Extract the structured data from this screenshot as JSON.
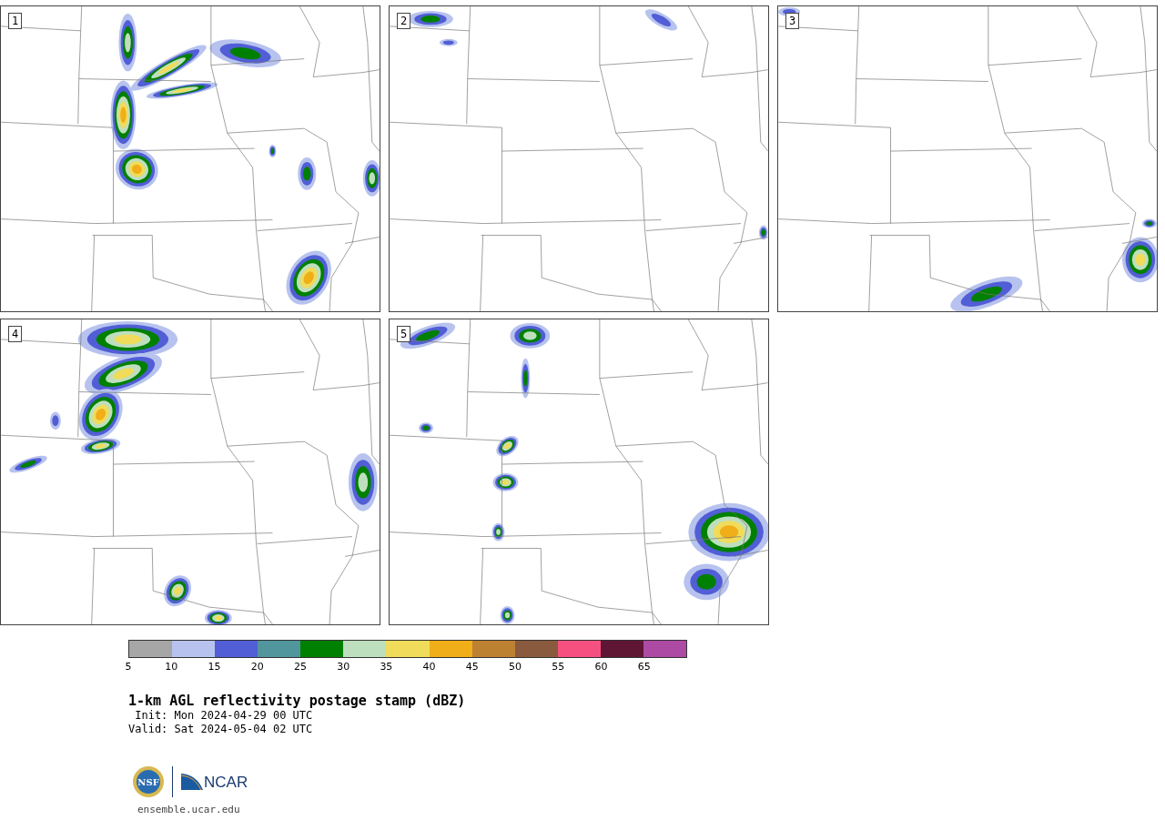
{
  "panels": [
    {
      "label": "1"
    },
    {
      "label": "2"
    },
    {
      "label": "3"
    },
    {
      "label": "4"
    },
    {
      "label": "5"
    }
  ],
  "colorbar": {
    "segments": [
      {
        "color": "#a6a6a6"
      },
      {
        "color": "#b7c3ee"
      },
      {
        "color": "#515ed6"
      },
      {
        "color": "#51969c"
      },
      {
        "color": "#008000"
      },
      {
        "color": "#bedfbe"
      },
      {
        "color": "#f0dc5a"
      },
      {
        "color": "#f0ae18"
      },
      {
        "color": "#bc8232"
      },
      {
        "color": "#8a5a3e"
      },
      {
        "color": "#f55080"
      },
      {
        "color": "#5e1634"
      },
      {
        "color": "#ac4aa4"
      }
    ],
    "ticks": [
      "5",
      "10",
      "15",
      "20",
      "25",
      "30",
      "35",
      "40",
      "45",
      "50",
      "55",
      "60",
      "65"
    ]
  },
  "title": "1-km AGL reflectivity postage stamp (dBZ)",
  "init": " Init: Mon 2024-04-29 00 UTC",
  "valid": "Valid: Sat 2024-05-04 02 UTC",
  "logos": {
    "nsf": "NSF",
    "ncar": "NCAR"
  },
  "footer": "ensemble.ucar.edu"
}
